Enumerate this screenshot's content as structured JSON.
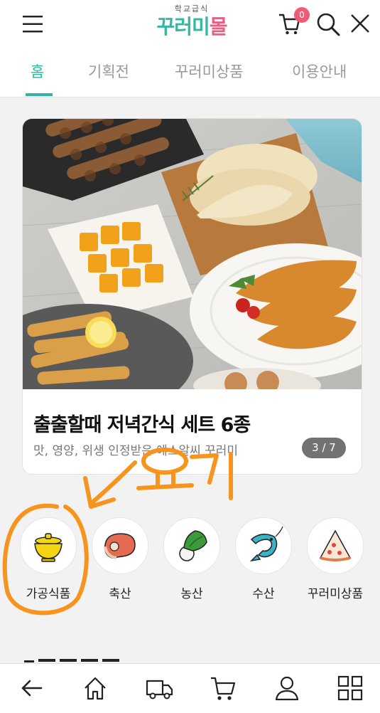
{
  "header": {
    "logo_small": "학교급식",
    "logo_part1": "꾸러미",
    "logo_part2": "몰",
    "cart_count": "0",
    "icons": [
      "menu-icon",
      "cart-icon",
      "search-icon",
      "close-icon"
    ]
  },
  "tabs": [
    {
      "label": "홈",
      "active": true
    },
    {
      "label": "기획전",
      "active": false
    },
    {
      "label": "꾸러미상품",
      "active": false
    },
    {
      "label": "이용안내",
      "active": false
    }
  ],
  "banner": {
    "title": "출출할때 저녁간식 세트 6종",
    "subtitle": "맛, 영양, 위생 인정받은 에스알씨 꾸러미",
    "counter": "3 / 7"
  },
  "annotation": {
    "text": "요기",
    "color": "#f7941d"
  },
  "categories": [
    {
      "label": "가공식품",
      "icon": "bowl-icon"
    },
    {
      "label": "축산",
      "icon": "meat-icon"
    },
    {
      "label": "농산",
      "icon": "vegetable-icon"
    },
    {
      "label": "수산",
      "icon": "shrimp-icon"
    },
    {
      "label": "꾸러미상품",
      "icon": "pizza-icon"
    }
  ],
  "bottom_nav": [
    {
      "name": "back",
      "icon": "back-arrow-icon"
    },
    {
      "name": "home",
      "icon": "home-icon"
    },
    {
      "name": "delivery",
      "icon": "truck-icon"
    },
    {
      "name": "cart",
      "icon": "cart-icon"
    },
    {
      "name": "mypage",
      "icon": "user-icon"
    },
    {
      "name": "all-menu",
      "icon": "grid-icon"
    }
  ],
  "colors": {
    "accent": "#2fb5a3",
    "pink": "#e95f82",
    "badge": "#ef5a76"
  }
}
